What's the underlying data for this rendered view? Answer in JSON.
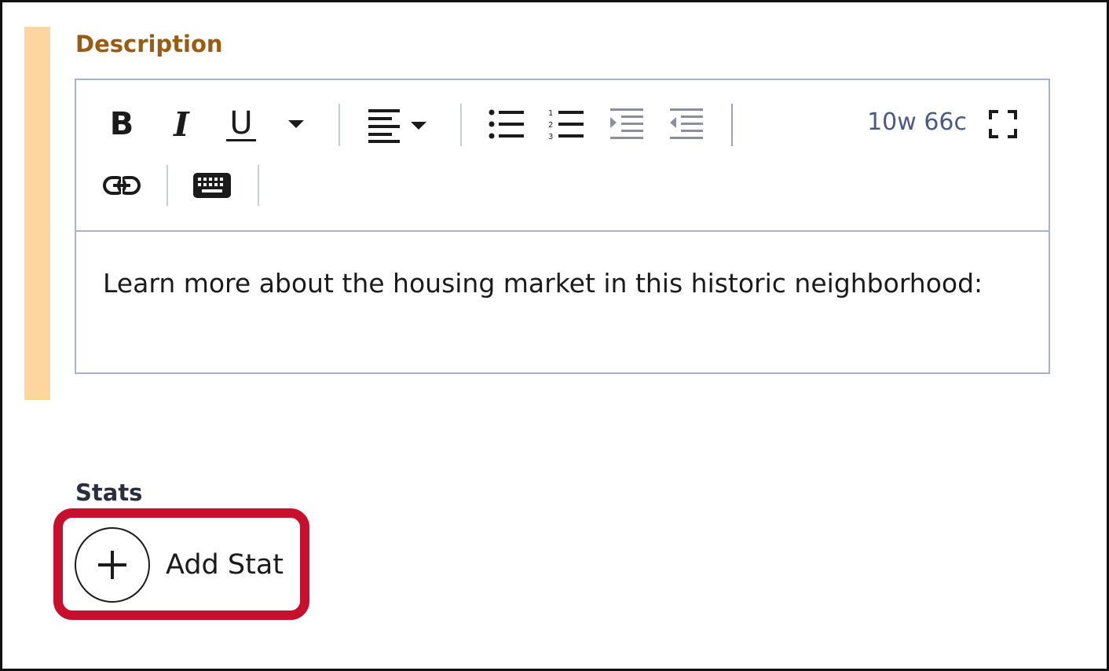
{
  "description": {
    "label": "Description"
  },
  "editor": {
    "toolbar": {
      "bold_label": "B",
      "italic_label": "I",
      "underline_label": "U",
      "word_count": "10w 66c"
    },
    "content": "Learn more about the housing market in this historic neighborhood:"
  },
  "stats": {
    "label": "Stats",
    "add_label": "Add Stat"
  },
  "icons": {
    "more_format": "chevron-down-icon",
    "align": "align-left-icon",
    "bullet_list": "bullet-list-icon",
    "numbered_list": "numbered-list-icon",
    "indent": "indent-icon",
    "outdent": "outdent-icon",
    "fullscreen": "fullscreen-icon",
    "link": "link-icon",
    "keyboard": "keyboard-icon",
    "add": "plus-icon"
  },
  "colors": {
    "accent_bar": "#fcd59f",
    "description_label": "#9a5b12",
    "editor_border": "#a9b1cc",
    "word_count": "#4d5a80",
    "highlight": "#c8102e"
  }
}
